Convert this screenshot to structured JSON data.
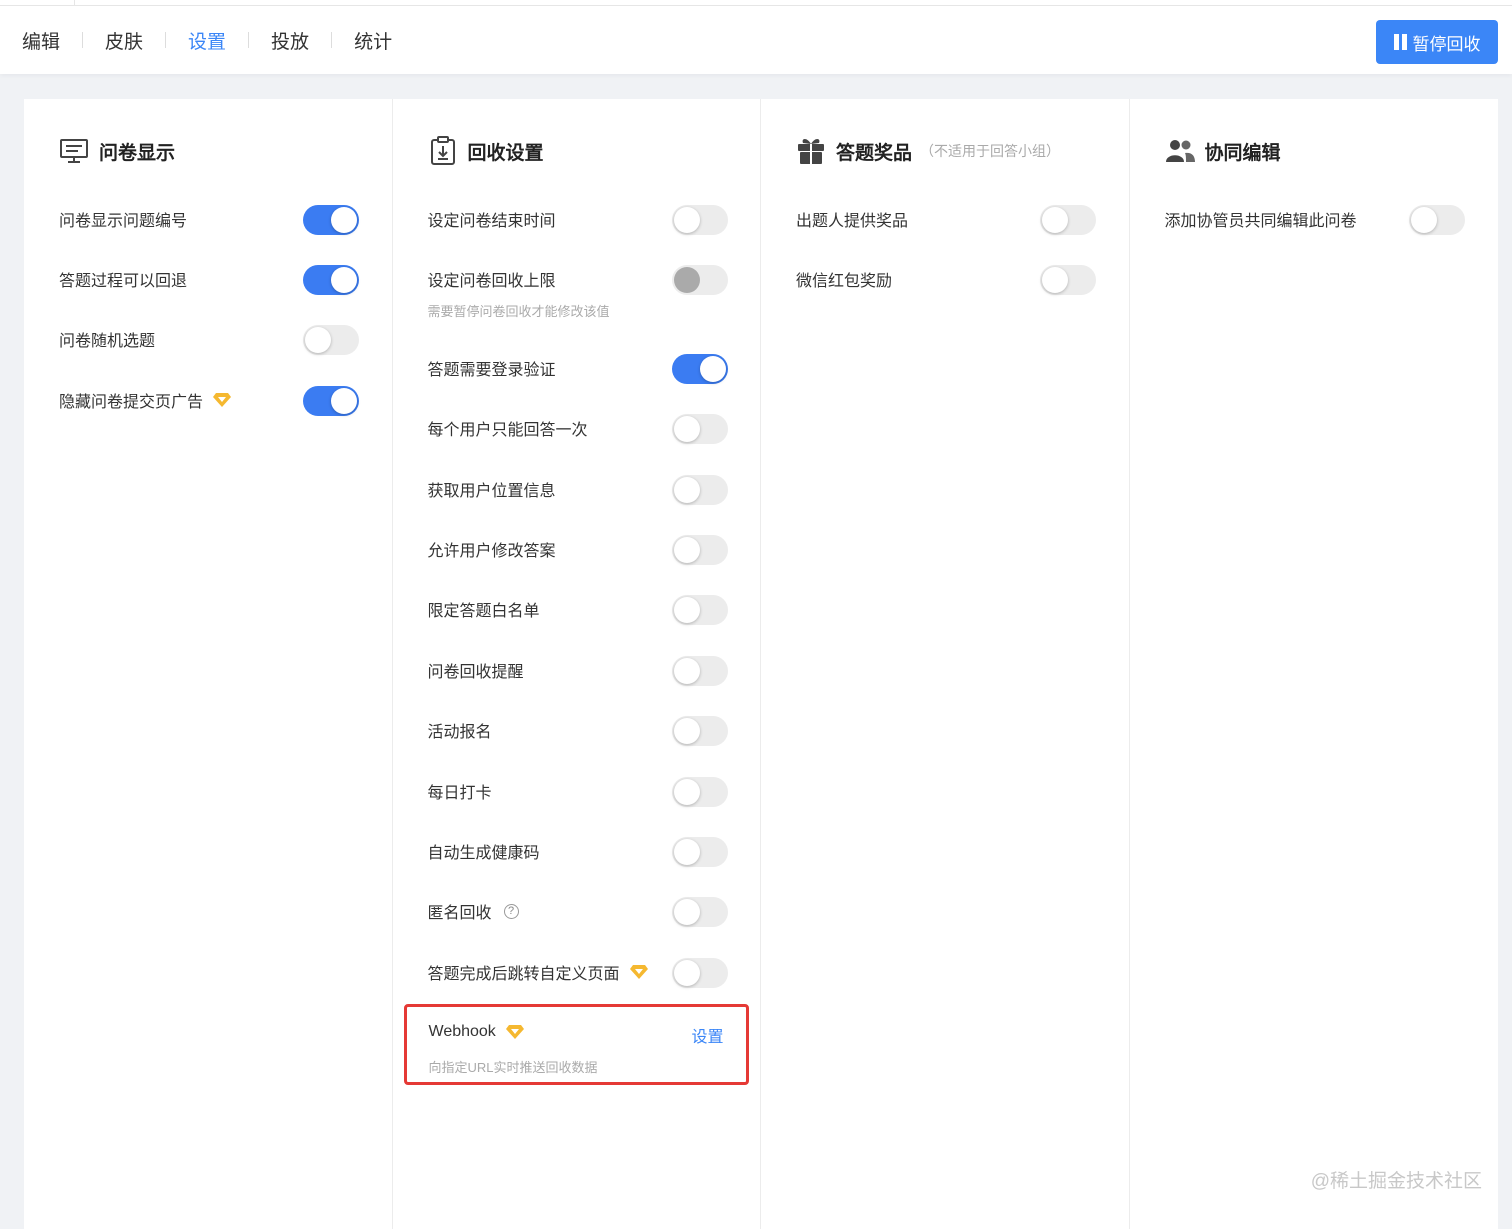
{
  "tabs": [
    "编辑",
    "皮肤",
    "设置",
    "投放",
    "统计"
  ],
  "active_tab": "设置",
  "pause_button": "暂停回收",
  "accent_color": "#3b86f7",
  "display": {
    "title": "问卷显示",
    "icon": "monitor-icon",
    "items": [
      {
        "label": "问卷显示问题编号",
        "on": true
      },
      {
        "label": "答题过程可以回退",
        "on": true
      },
      {
        "label": "问卷随机选题",
        "on": false
      },
      {
        "label": "隐藏问卷提交页广告",
        "on": true,
        "premium": true
      }
    ]
  },
  "collect": {
    "title": "回收设置",
    "icon": "clipboard-download-icon",
    "items": [
      {
        "label": "设定问卷结束时间",
        "on": false
      },
      {
        "label": "设定问卷回收上限",
        "on": false,
        "disabled": true,
        "sub": "需要暂停问卷回收才能修改该值"
      },
      {
        "label": "答题需要登录验证",
        "on": true
      },
      {
        "label": "每个用户只能回答一次",
        "on": false
      },
      {
        "label": "获取用户位置信息",
        "on": false
      },
      {
        "label": "允许用户修改答案",
        "on": false
      },
      {
        "label": "限定答题白名单",
        "on": false
      },
      {
        "label": "问卷回收提醒",
        "on": false
      },
      {
        "label": "活动报名",
        "on": false
      },
      {
        "label": "每日打卡",
        "on": false
      },
      {
        "label": "自动生成健康码",
        "on": false
      },
      {
        "label": "匿名回收",
        "on": false,
        "help": "?"
      },
      {
        "label": "答题完成后跳转自定义页面",
        "on": false,
        "premium": true
      }
    ],
    "webhook": {
      "label": "Webhook",
      "link": "设置",
      "sub": "向指定URL实时推送回收数据"
    }
  },
  "prize": {
    "title": "答题奖品",
    "note": "（不适用于回答小组）",
    "icon": "gift-icon",
    "items": [
      {
        "label": "出题人提供奖品",
        "on": false
      },
      {
        "label": "微信红包奖励",
        "on": false
      }
    ]
  },
  "collab": {
    "title": "协同编辑",
    "icon": "users-icon",
    "items": [
      {
        "label": "添加协管员共同编辑此问卷",
        "on": false
      }
    ]
  },
  "watermark": "@稀土掘金技术社区"
}
